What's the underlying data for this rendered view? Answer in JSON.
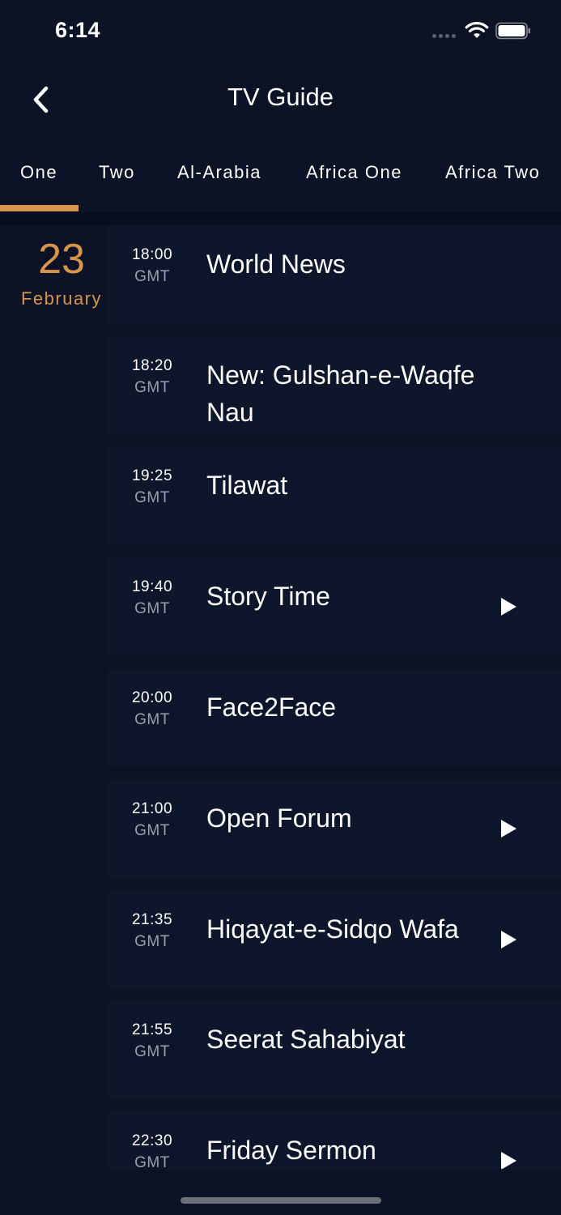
{
  "status_bar": {
    "time": "6:14"
  },
  "header": {
    "title": "TV Guide",
    "back_icon": "chevron-left-icon"
  },
  "tabs": [
    {
      "label": "One",
      "active": true
    },
    {
      "label": "Two",
      "active": false
    },
    {
      "label": "Al-Arabia",
      "active": false
    },
    {
      "label": "Africa One",
      "active": false
    },
    {
      "label": "Africa Two",
      "active": false
    }
  ],
  "date": {
    "day": "23",
    "month": "February"
  },
  "programs": [
    {
      "time": "18:00",
      "tz": "GMT",
      "title": "World News",
      "playable": false
    },
    {
      "time": "18:20",
      "tz": "GMT",
      "title": "New: Gulshan-e-Waqfe Nau",
      "playable": false
    },
    {
      "time": "19:25",
      "tz": "GMT",
      "title": "Tilawat",
      "playable": false
    },
    {
      "time": "19:40",
      "tz": "GMT",
      "title": "Story Time",
      "playable": true
    },
    {
      "time": "20:00",
      "tz": "GMT",
      "title": "Face2Face",
      "playable": false
    },
    {
      "time": "21:00",
      "tz": "GMT",
      "title": "Open Forum",
      "playable": true
    },
    {
      "time": "21:35",
      "tz": "GMT",
      "title": "Hiqayat-e-Sidqo Wafa",
      "playable": true
    },
    {
      "time": "21:55",
      "tz": "GMT",
      "title": "Seerat Sahabiyat",
      "playable": false
    },
    {
      "time": "22:30",
      "tz": "GMT",
      "title": "Friday Sermon",
      "playable": true
    }
  ],
  "colors": {
    "background": "#0c1326",
    "card": "#0d162b",
    "accent": "#d7944b",
    "text": "#ffffff",
    "muted": "#9aa0ab"
  }
}
